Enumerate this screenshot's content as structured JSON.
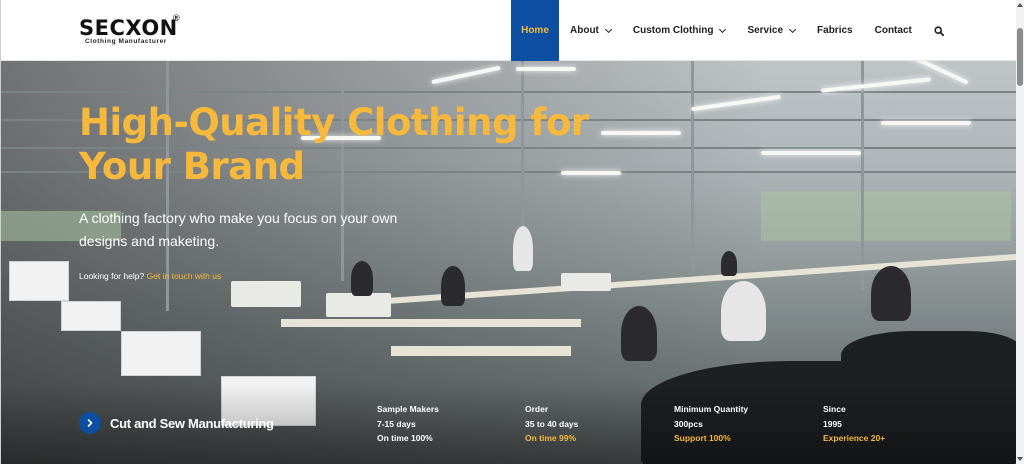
{
  "brand": {
    "name": "SECXON",
    "registered": "®",
    "tagline": "Clothing Manufacturer"
  },
  "nav": {
    "items": [
      {
        "label": "Home",
        "active": true,
        "dropdown": false
      },
      {
        "label": "About",
        "active": false,
        "dropdown": true
      },
      {
        "label": "Custom Clothing",
        "active": false,
        "dropdown": true
      },
      {
        "label": "Service",
        "active": false,
        "dropdown": true
      },
      {
        "label": "Fabrics",
        "active": false,
        "dropdown": false
      },
      {
        "label": "Contact",
        "active": false,
        "dropdown": false
      }
    ],
    "search_icon": "search-icon"
  },
  "hero": {
    "title": "High-Quality Clothing for Your Brand",
    "subtitle": "A clothing factory who make you focus on your own designs and maketing.",
    "help_text": "Looking for help?",
    "help_link": "Get in touch with us",
    "cta_label": "Cut and Sew Manufacturing",
    "cta_icon": "chevron-right-icon"
  },
  "stats": [
    {
      "title": "Sample Makers",
      "value": "7-15 days",
      "highlight": "On time 100%"
    },
    {
      "title": "Order",
      "value": "35 to 40 days",
      "highlight": "On time 99%"
    },
    {
      "title": "Minimum Quantity",
      "value": "300pcs",
      "highlight": "Support 100%"
    },
    {
      "title": "Since",
      "value": "1995",
      "highlight": "Experience 20+"
    }
  ],
  "colors": {
    "accent": "#f6b93b",
    "primary": "#0b4ea2",
    "text_dark": "#1e1e1e"
  }
}
